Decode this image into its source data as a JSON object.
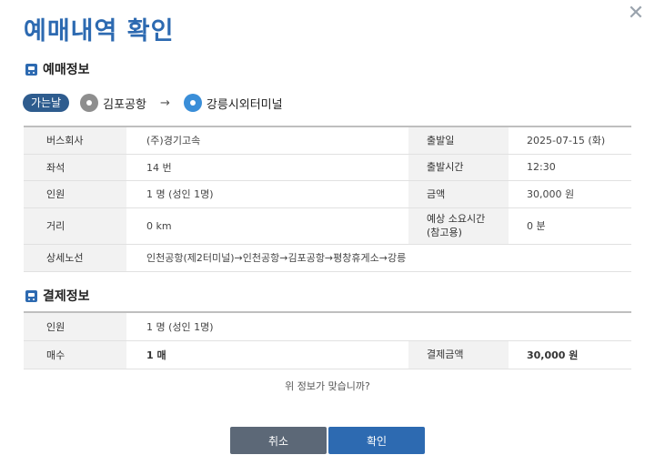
{
  "dialog": {
    "title": "예매내역 확인",
    "close": "✕"
  },
  "booking_section": {
    "title": "예매정보",
    "route": {
      "badge": "가는날",
      "from": "김포공항",
      "arrow": "→",
      "to": "강릉시외터미널"
    },
    "rows": [
      {
        "l1": "버스회사",
        "v1": "(주)경기고속",
        "l2": "출발일",
        "v2": "2025-07-15 (화)"
      },
      {
        "l1": "좌석",
        "v1": "14 번",
        "l2": "출발시간",
        "v2": "12:30"
      },
      {
        "l1": "인원",
        "v1": "1 명 (성인 1명)",
        "l2": "금액",
        "v2": "30,000 원"
      },
      {
        "l1": "거리",
        "v1": "0 km",
        "l2": "예상 소요시간\n(참고용)",
        "v2": "0 분"
      }
    ],
    "detail_route": {
      "label": "상세노선",
      "value": "인천공항(제2터미널)→인천공항→김포공항→평창휴게소→강릉"
    }
  },
  "payment_section": {
    "title": "결제정보",
    "people_label": "인원",
    "people_value": "1 명 (성인 1명)",
    "count_label": "매수",
    "count_value": "1 매",
    "total_label": "결제금액",
    "total_value": "30,000 원"
  },
  "confirm_question": "위 정보가 맞습니까?",
  "buttons": {
    "cancel": "취소",
    "ok": "확인"
  }
}
